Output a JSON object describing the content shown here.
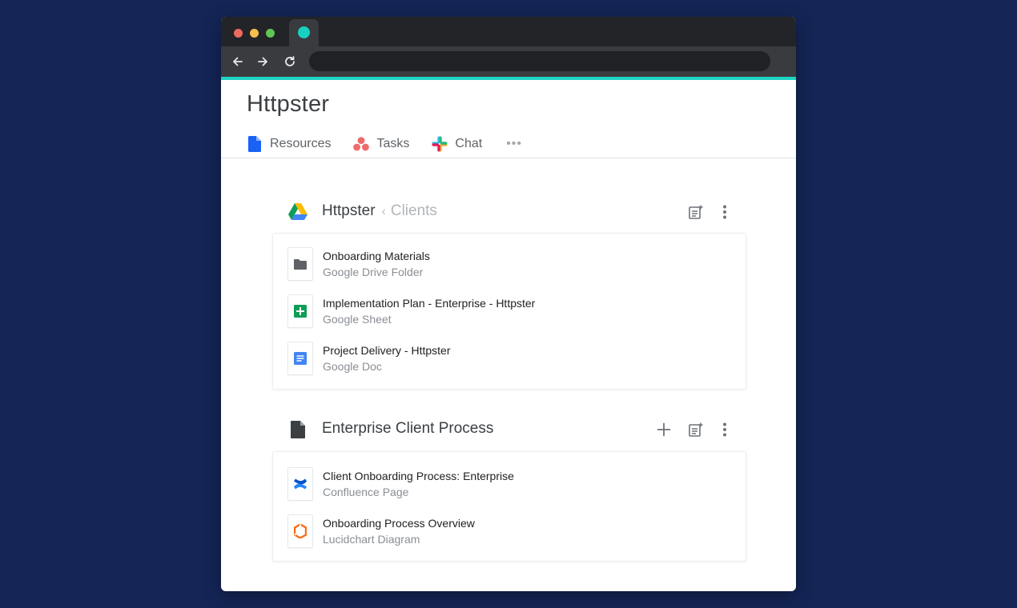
{
  "app": {
    "title": "Httpster",
    "tabs": [
      {
        "label": "Resources",
        "icon": "document-icon"
      },
      {
        "label": "Tasks",
        "icon": "asana-icon"
      },
      {
        "label": "Chat",
        "icon": "slack-icon"
      }
    ],
    "more_label": "•••"
  },
  "sections": [
    {
      "icon": "google-drive-icon",
      "title": "Httpster",
      "breadcrumb_sep": "‹",
      "breadcrumb": "Clients",
      "items": [
        {
          "name": "Onboarding Materials",
          "type": "Google Drive Folder",
          "icon": "folder-icon"
        },
        {
          "name": "Implementation Plan - Enterprise - Httpster",
          "type": "Google Sheet",
          "icon": "google-sheet-icon"
        },
        {
          "name": "Project Delivery - Httpster",
          "type": "Google Doc",
          "icon": "google-doc-icon"
        }
      ]
    },
    {
      "icon": "document-icon",
      "title": "Enterprise Client Process",
      "items": [
        {
          "name": "Client Onboarding Process: Enterprise",
          "type": "Confluence Page",
          "icon": "confluence-icon"
        },
        {
          "name": "Onboarding Process Overview",
          "type": "Lucidchart Diagram",
          "icon": "lucidchart-icon"
        }
      ]
    }
  ],
  "colors": {
    "background": "#142556",
    "accent": "#1ed5c5",
    "tab_favicon": "#17d0c0",
    "resources_icon": "#1a61f5"
  }
}
